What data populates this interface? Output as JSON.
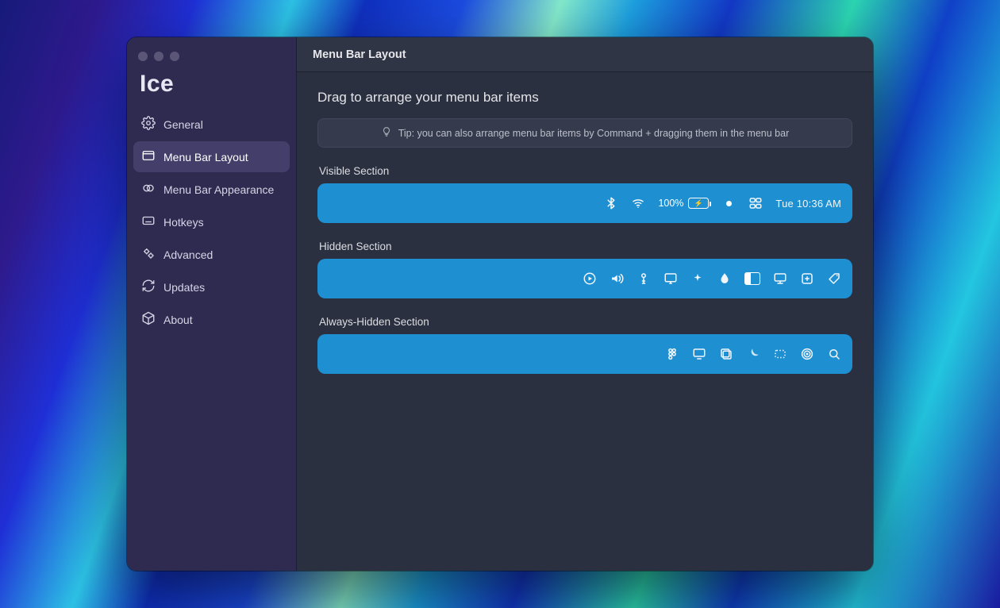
{
  "app_name": "Ice",
  "window_title": "Menu Bar Layout",
  "sidebar": {
    "items": [
      {
        "label": "General",
        "icon": "gear-icon",
        "active": false
      },
      {
        "label": "Menu Bar Layout",
        "icon": "layout-icon",
        "active": true
      },
      {
        "label": "Menu Bar Appearance",
        "icon": "appearance-icon",
        "active": false
      },
      {
        "label": "Hotkeys",
        "icon": "keyboard-icon",
        "active": false
      },
      {
        "label": "Advanced",
        "icon": "gears-icon",
        "active": false
      },
      {
        "label": "Updates",
        "icon": "refresh-icon",
        "active": false
      },
      {
        "label": "About",
        "icon": "cube-icon",
        "active": false
      }
    ]
  },
  "main": {
    "heading": "Drag to arrange your menu bar items",
    "tip": "Tip: you can also arrange menu bar items by Command + dragging them in the menu bar",
    "sections": [
      {
        "label": "Visible Section",
        "items": [
          {
            "id": "bluetooth-icon"
          },
          {
            "id": "wifi-icon"
          },
          {
            "id": "battery-status",
            "percent": "100%"
          },
          {
            "id": "dot-icon"
          },
          {
            "id": "control-center-icon"
          },
          {
            "id": "clock-text",
            "text": "Tue 10:36 AM"
          }
        ]
      },
      {
        "label": "Hidden Section",
        "items": [
          {
            "id": "play-circle-icon"
          },
          {
            "id": "volume-icon"
          },
          {
            "id": "key-icon"
          },
          {
            "id": "airplay-icon"
          },
          {
            "id": "sparkle-icon"
          },
          {
            "id": "drop-icon"
          },
          {
            "id": "panel-split-icon"
          },
          {
            "id": "display-icon"
          },
          {
            "id": "plus-square-icon"
          },
          {
            "id": "tag-icon"
          }
        ]
      },
      {
        "label": "Always-Hidden Section",
        "items": [
          {
            "id": "figma-icon"
          },
          {
            "id": "monitor-icon"
          },
          {
            "id": "windows-stack-icon"
          },
          {
            "id": "moon-icon"
          },
          {
            "id": "dotted-rect-icon"
          },
          {
            "id": "airdrop-icon"
          },
          {
            "id": "search-icon"
          }
        ]
      }
    ]
  }
}
